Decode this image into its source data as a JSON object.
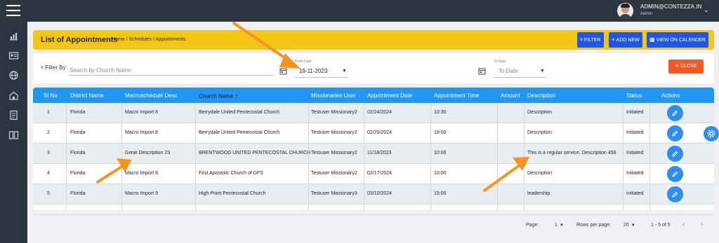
{
  "topbar": {
    "user_email": "ADMIN@CONTEZZA.IN",
    "user_role": "Admin"
  },
  "header": {
    "title": "List of Appointments",
    "breadcrumb": "Home / Schedules / Appointments",
    "filter_btn": "FILTER",
    "add_new_btn": "ADD NEW",
    "calendar_btn": "VIEW ON CALENDER"
  },
  "filters": {
    "filter_by_label": "Filter By",
    "search_placeholder": "Search by Church Name",
    "from_date_caption": "From Date",
    "from_date_value": "19-11-2023",
    "to_date_caption": "To Date",
    "to_date_placeholder": "To Date",
    "close_btn": "CLOSE"
  },
  "table": {
    "columns": [
      "Sl No",
      "District Name",
      "Macroschedule Desc",
      "Church Name",
      "Missionaries User",
      "Appointment Date",
      "Appointment Time",
      "Amount",
      "Description",
      "Status",
      "Actions"
    ],
    "rows": [
      [
        "1",
        "Florida",
        "Macro Import 8",
        "Berrydale United Pentecostal Church",
        "Testuser Missionary2",
        "02/24/2024",
        "10:30",
        "",
        "Description",
        "Initiated"
      ],
      [
        "2",
        "Florida",
        "Macro Import 8",
        "Berrydale United Pentecostal Church",
        "Testuser Missionary2",
        "02/20/2024",
        "19:00",
        "",
        "Description",
        "Initiated"
      ],
      [
        "3",
        "Florida",
        "Great Description 23",
        "BRENTWOOD UNITED PENTECOSTAL CHURCH",
        "Testuser Missionary2",
        "11/18/2023",
        "10:00",
        "",
        "This is a regular service. Description 456",
        "Initiated"
      ],
      [
        "4",
        "Florida",
        "Macro Import 8",
        "First Apostolic Church of DFS",
        "Testuser Missionary2",
        "02/17/2024",
        "10:00",
        "",
        "Description",
        "Initiated"
      ],
      [
        "5",
        "Florida",
        "Macro Import 9",
        "High Point Pentecostal Church",
        "Testuser Missionary3",
        "03/10/2024",
        "15:00",
        "",
        "leadership",
        "Initiated"
      ]
    ]
  },
  "pagination": {
    "page_label": "Page:",
    "page_value": "1",
    "rows_label": "Rows per page:",
    "rows_value": "20",
    "range": "1 - 5 of 5"
  },
  "colors": {
    "header_band": "#f3c515",
    "primary": "#2156e5",
    "table_header": "#2196f3",
    "close": "#f15a24",
    "annotation_arrow": "#f7941d"
  }
}
